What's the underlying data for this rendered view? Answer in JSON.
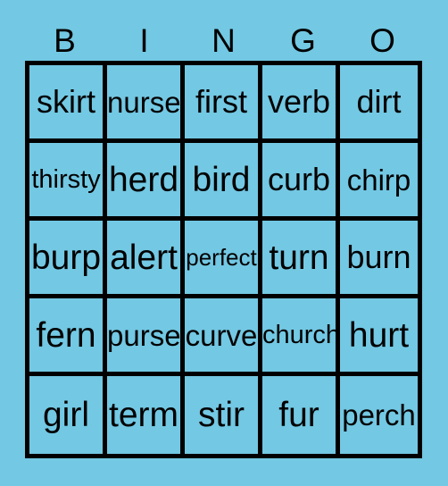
{
  "card": {
    "background_color": "#73c8e3",
    "line_color": "#000000",
    "text_color": "#000000",
    "header": {
      "letters": [
        "B",
        "I",
        "N",
        "G",
        "O"
      ]
    },
    "grid": {
      "columns": 5,
      "rows": 5,
      "cells": [
        [
          {
            "word": "skirt",
            "size": "lg"
          },
          {
            "word": "nurse",
            "size": "md"
          },
          {
            "word": "first",
            "size": "lg"
          },
          {
            "word": "verb",
            "size": "lg"
          },
          {
            "word": "dirt",
            "size": "lg"
          }
        ],
        [
          {
            "word": "thirsty",
            "size": "sm"
          },
          {
            "word": "herd",
            "size": "xl"
          },
          {
            "word": "bird",
            "size": "xl"
          },
          {
            "word": "curb",
            "size": "lg"
          },
          {
            "word": "chirp",
            "size": "md"
          }
        ],
        [
          {
            "word": "burp",
            "size": "xl"
          },
          {
            "word": "alert",
            "size": "xl"
          },
          {
            "word": "perfect",
            "size": "xs"
          },
          {
            "word": "turn",
            "size": "xl"
          },
          {
            "word": "burn",
            "size": "lg"
          }
        ],
        [
          {
            "word": "fern",
            "size": "xl"
          },
          {
            "word": "purse",
            "size": "md"
          },
          {
            "word": "curve",
            "size": "md"
          },
          {
            "word": "church",
            "size": "sm"
          },
          {
            "word": "hurt",
            "size": "xl"
          }
        ],
        [
          {
            "word": "girl",
            "size": "xl"
          },
          {
            "word": "term",
            "size": "xl"
          },
          {
            "word": "stir",
            "size": "xl"
          },
          {
            "word": "fur",
            "size": "xl"
          },
          {
            "word": "perch",
            "size": "md"
          }
        ]
      ]
    }
  }
}
